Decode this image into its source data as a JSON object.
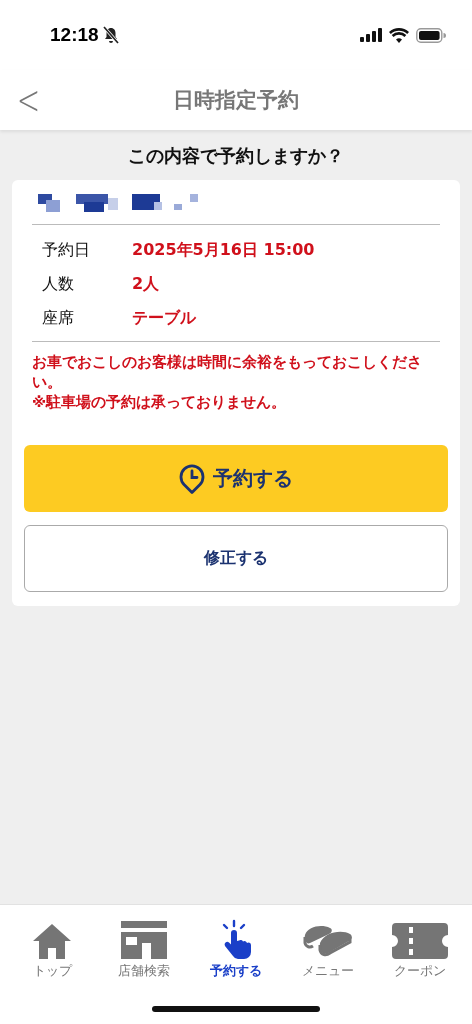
{
  "status_bar": {
    "time": "12:18"
  },
  "header": {
    "back": "<",
    "title": "日時指定予約"
  },
  "question": "この内容で予約しますか？",
  "details": [
    {
      "label": "予約日",
      "value": "2025年5月16日 15:00"
    },
    {
      "label": "人数",
      "value": "2人"
    },
    {
      "label": "座席",
      "value": "テーブル"
    }
  ],
  "notes": [
    "お車でおこしのお客様は時間に余裕をもっておこしください。",
    "※駐車場の予約は承っておりません。"
  ],
  "buttons": [
    {
      "kind": "primary",
      "label": "予約する"
    },
    {
      "kind": "secondary",
      "label": "修正する"
    }
  ],
  "tabs": [
    {
      "kind": "home",
      "label": "トップ",
      "selected": false
    },
    {
      "kind": "store",
      "label": "店舗検索",
      "selected": false
    },
    {
      "kind": "tap",
      "label": "予約する",
      "selected": true
    },
    {
      "kind": "sushi",
      "label": "メニュー",
      "selected": false
    },
    {
      "kind": "ticket",
      "label": "クーポン",
      "selected": false
    }
  ]
}
